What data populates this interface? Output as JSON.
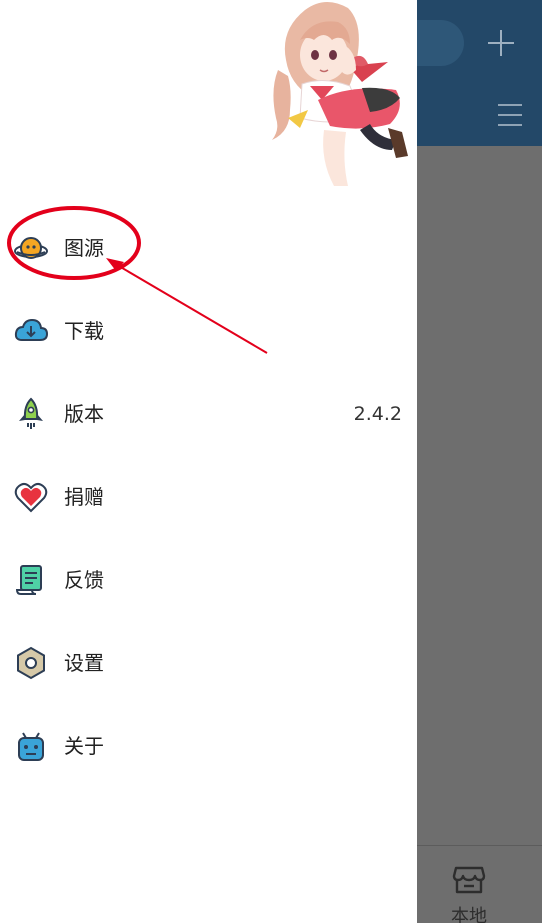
{
  "background": {
    "bottom_nav": {
      "local_label": "本地"
    }
  },
  "drawer": {
    "items": [
      {
        "label": "图源",
        "icon": "planet-icon",
        "value": ""
      },
      {
        "label": "下载",
        "icon": "cloud-download-icon",
        "value": ""
      },
      {
        "label": "版本",
        "icon": "rocket-icon",
        "value": "2.4.2"
      },
      {
        "label": "捐赠",
        "icon": "heart-icon",
        "value": ""
      },
      {
        "label": "反馈",
        "icon": "document-icon",
        "value": ""
      },
      {
        "label": "设置",
        "icon": "hex-nut-icon",
        "value": ""
      },
      {
        "label": "关于",
        "icon": "robot-icon",
        "value": ""
      }
    ]
  },
  "colors": {
    "appbar": "#234868",
    "scrim": "#6e6e6e",
    "annotation": "#e3001b"
  }
}
